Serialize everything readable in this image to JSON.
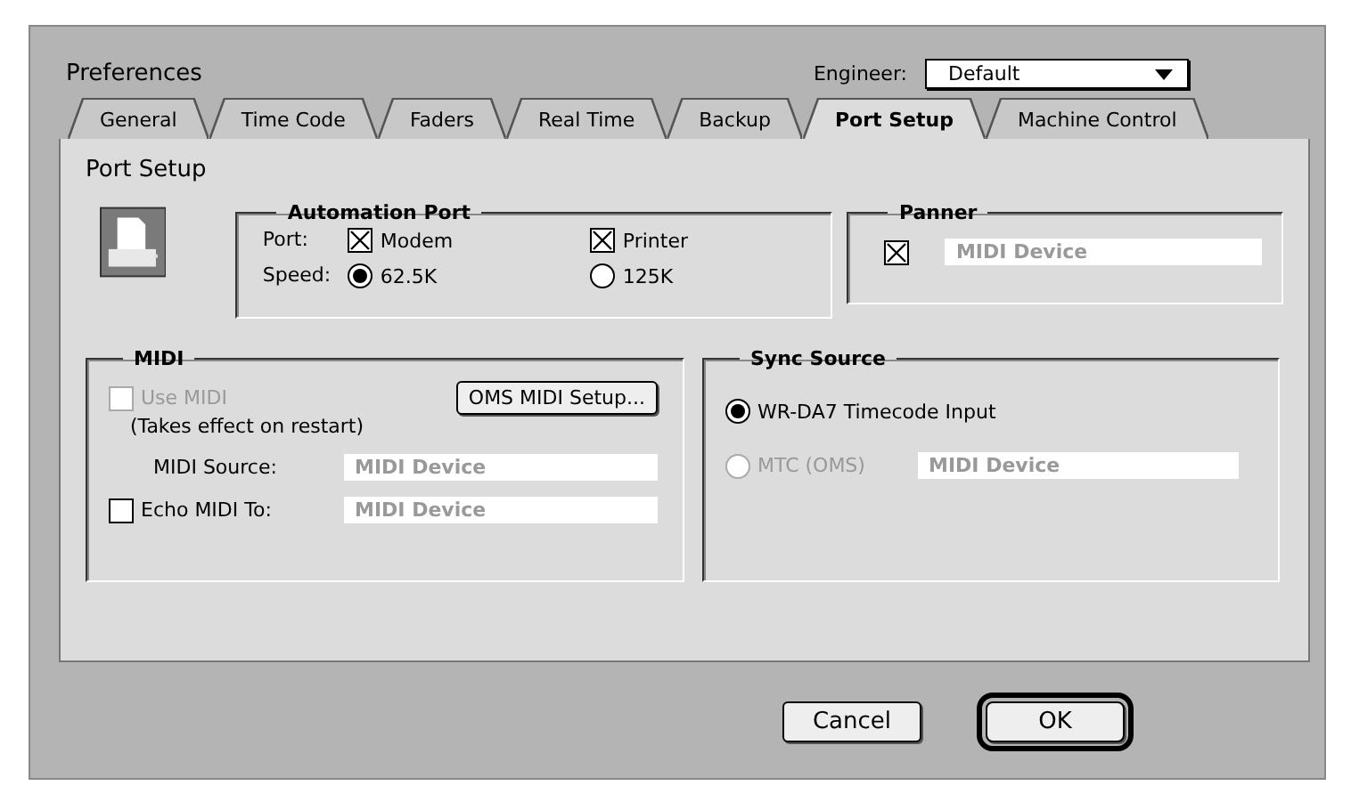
{
  "window": {
    "title": "Preferences"
  },
  "engineer": {
    "label": "Engineer:",
    "value": "Default"
  },
  "tabs": [
    {
      "label": "General",
      "selected": false
    },
    {
      "label": "Time Code",
      "selected": false
    },
    {
      "label": "Faders",
      "selected": false
    },
    {
      "label": "Real Time",
      "selected": false
    },
    {
      "label": "Backup",
      "selected": false
    },
    {
      "label": "Port Setup",
      "selected": true
    },
    {
      "label": "Machine Control",
      "selected": false
    }
  ],
  "panel_title": "Port Setup",
  "automation_port": {
    "title": "Automation Port",
    "port_label": "Port:",
    "port_options": [
      {
        "label": "Modem",
        "checked": true
      },
      {
        "label": "Printer",
        "checked": true
      }
    ],
    "speed_label": "Speed:",
    "speed_options": [
      {
        "label": "62.5K",
        "selected": true
      },
      {
        "label": "125K",
        "selected": false
      }
    ]
  },
  "panner": {
    "title": "Panner",
    "checked": true,
    "device": "MIDI Device"
  },
  "midi": {
    "title": "MIDI",
    "use_midi": {
      "label": "Use MIDI",
      "checked": false,
      "disabled": true
    },
    "note": "(Takes effect on restart)",
    "setup_button": "OMS MIDI Setup...",
    "source_label": "MIDI Source:",
    "source_value": "MIDI Device",
    "echo": {
      "label": "Echo MIDI To:",
      "checked": false,
      "value": "MIDI Device"
    }
  },
  "sync_source": {
    "title": "Sync Source",
    "options": [
      {
        "label": "WR-DA7 Timecode Input",
        "selected": true,
        "disabled": false
      },
      {
        "label": "MTC (OMS)",
        "selected": false,
        "disabled": true,
        "device": "MIDI Device"
      }
    ]
  },
  "buttons": [
    {
      "label": "Cancel",
      "default": false
    },
    {
      "label": "OK",
      "default": true
    }
  ]
}
